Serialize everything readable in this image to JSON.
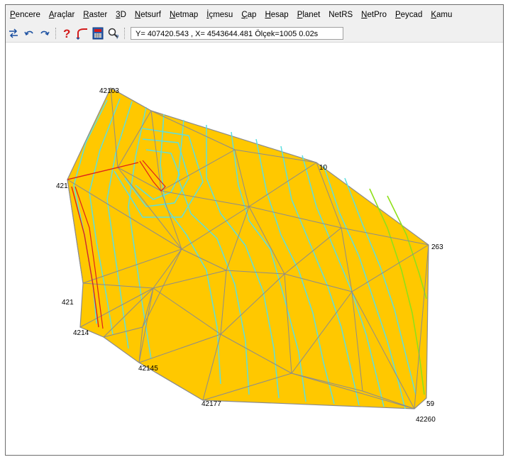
{
  "menu": {
    "items": [
      {
        "label": "Pencere",
        "key": "P",
        "rest": "encere"
      },
      {
        "label": "Araçlar",
        "key": "A",
        "rest": "raçlar"
      },
      {
        "label": "Raster",
        "key": "R",
        "rest": "aster"
      },
      {
        "label": "3D",
        "key": "3",
        "rest": "D"
      },
      {
        "label": "Netsurf",
        "key": "N",
        "rest": "etsurf"
      },
      {
        "label": "Netmap",
        "key": "N",
        "rest": "etmap"
      },
      {
        "label": "İçmesu",
        "key": "İ",
        "rest": "çmesu"
      },
      {
        "label": "Çap",
        "key": "Ç",
        "rest": "ap"
      },
      {
        "label": "Hesap",
        "key": "H",
        "rest": "esap"
      },
      {
        "label": "Planet",
        "key": "P",
        "rest": "lanet"
      },
      {
        "label": "NetRS",
        "key": "",
        "rest": "NetRS"
      },
      {
        "label": "NetPro",
        "key": "N",
        "rest": "etPro"
      },
      {
        "label": "Peycad",
        "key": "P",
        "rest": "eycad"
      },
      {
        "label": "Kamu",
        "key": "K",
        "rest": "amu"
      }
    ]
  },
  "toolbar": {
    "icons": [
      "swap-arrows-icon",
      "undo-icon",
      "redo-icon",
      "help-icon",
      "line-tool-icon",
      "calculator-icon",
      "zoom-query-icon"
    ],
    "status_text": "Y= 407420.543 , X= 4543644.481 Ölçek=1005   0.02s"
  },
  "map": {
    "colors": {
      "fill": "#ffc800",
      "edges": "#8c8c8c",
      "contours": "#5cdfe0",
      "contours_green": "#8fe01a",
      "breakline": "#e0201a"
    },
    "point_labels": {
      "p_top": "42103",
      "p_10": "10",
      "p_263": "263",
      "p_421a": "421",
      "p_421b": "421",
      "p_4214": "4214",
      "p_42145": "42145",
      "p_42177": "42177",
      "p_59": "59",
      "p_42260": "42260"
    }
  }
}
